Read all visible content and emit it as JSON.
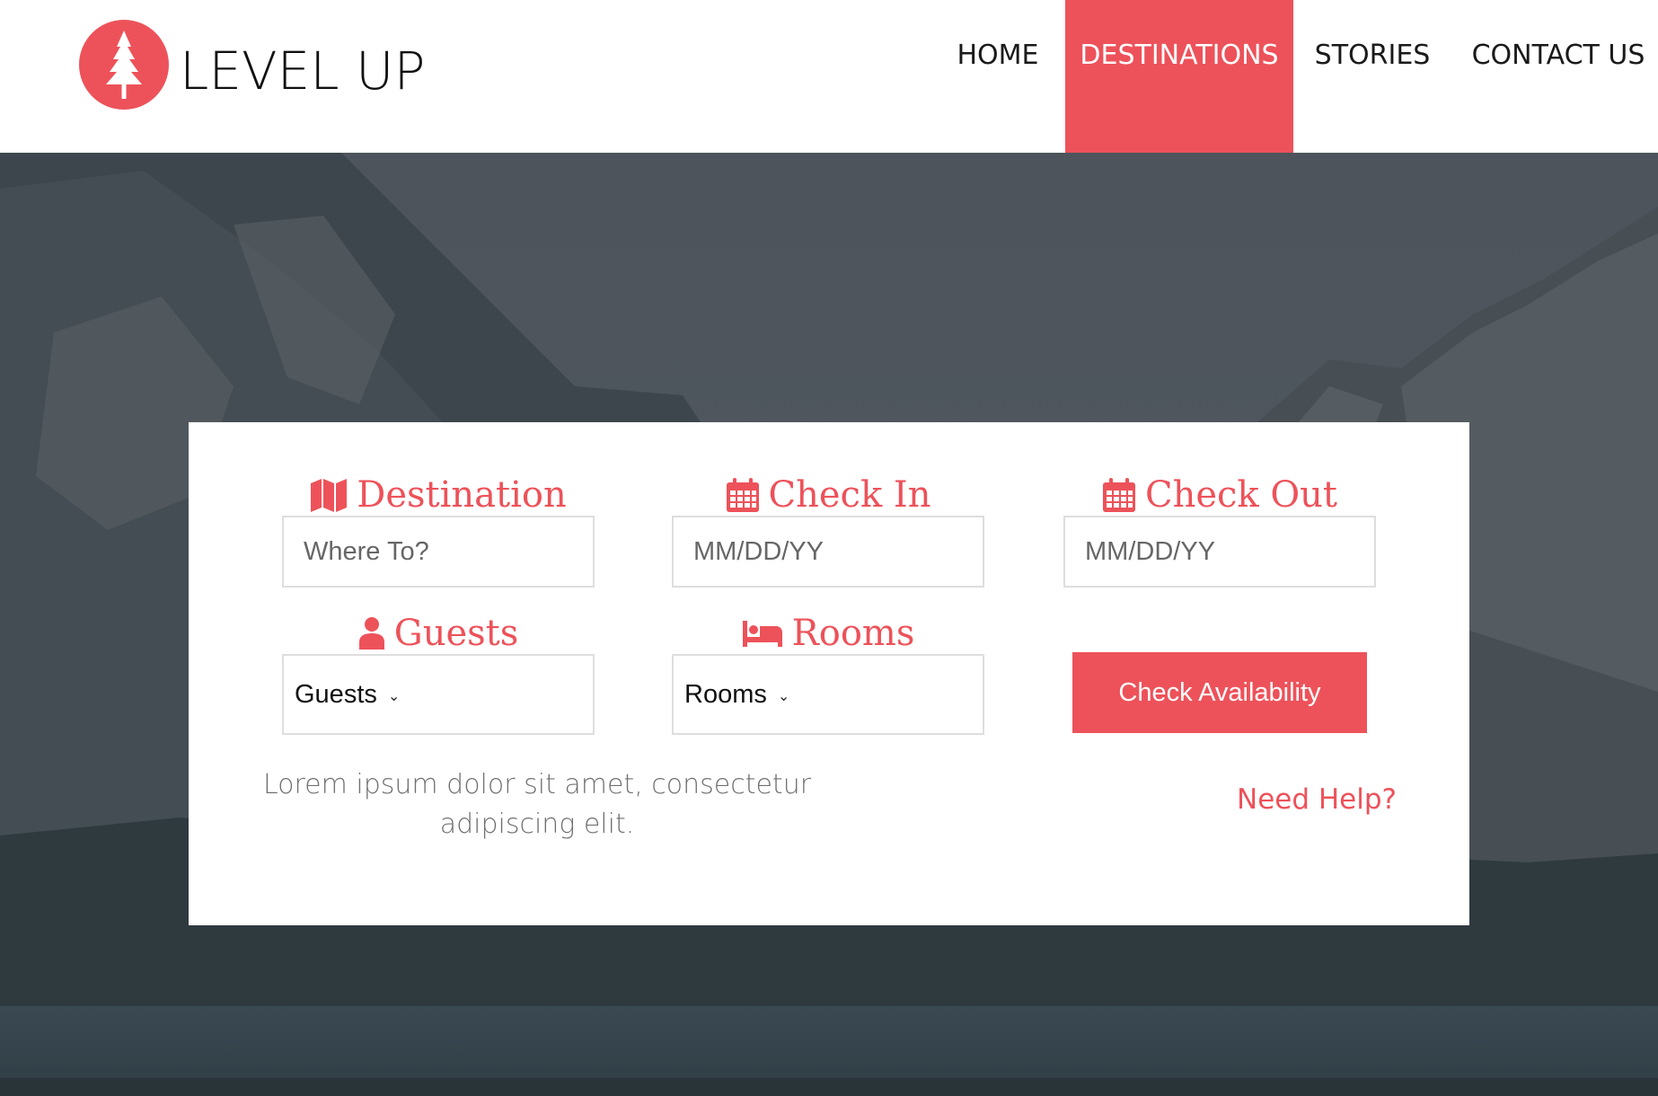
{
  "brand": {
    "name": "LEVEL UP",
    "logo_icon": "tree-icon"
  },
  "nav": {
    "items": [
      {
        "label": "HOME",
        "active": false
      },
      {
        "label": "DESTINATIONS",
        "active": true
      },
      {
        "label": "STORIES",
        "active": false
      },
      {
        "label": "CONTACT US",
        "active": false
      }
    ]
  },
  "form": {
    "destination": {
      "label": "Destination",
      "icon": "map-icon",
      "placeholder": "Where To?"
    },
    "check_in": {
      "label": "Check In",
      "icon": "calendar-icon",
      "placeholder": "MM/DD/YY"
    },
    "check_out": {
      "label": "Check Out",
      "icon": "calendar-icon",
      "placeholder": "MM/DD/YY"
    },
    "guests": {
      "label": "Guests",
      "icon": "user-icon",
      "value": "Guests"
    },
    "rooms": {
      "label": "Rooms",
      "icon": "bed-icon",
      "value": "Rooms"
    },
    "submit_label": "Check Availability",
    "description": "Lorem ipsum dolor sit amet, consectetur adipiscing elit.",
    "help_link": "Need Help?"
  },
  "colors": {
    "accent": "#ed525a",
    "hero_overlay": "#3f4950",
    "text_dark": "#111111",
    "muted_text": "#707070"
  }
}
